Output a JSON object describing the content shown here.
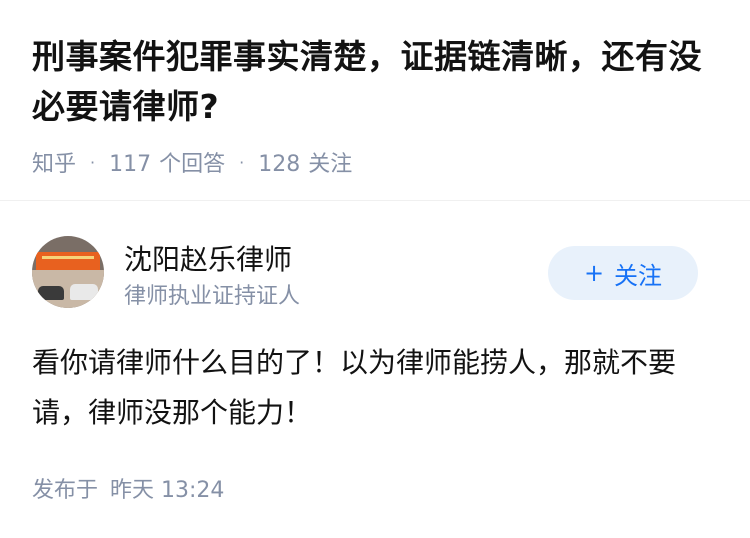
{
  "question": {
    "title": "刑事案件犯罪事实清楚，证据链清晰，还有没必要请律师?",
    "source": "知乎",
    "answers_count": "117",
    "answers_label": "个回答",
    "followers_count": "128",
    "followers_label": "关注"
  },
  "answer": {
    "author": {
      "name": "沈阳赵乐律师",
      "badge": "律师执业证持证人"
    },
    "follow_button": {
      "icon": "plus-icon",
      "icon_glyph": "+",
      "label": "关注"
    },
    "content": "看你请律师什么目的了！以为律师能捞人，那就不要请，律师没那个能力！",
    "publish_label": "发布于",
    "publish_time": "昨天 13:24"
  },
  "colors": {
    "text_primary": "#121212",
    "text_secondary": "#8590a6",
    "accent": "#1772f6",
    "button_bg": "#e8f1fb"
  }
}
